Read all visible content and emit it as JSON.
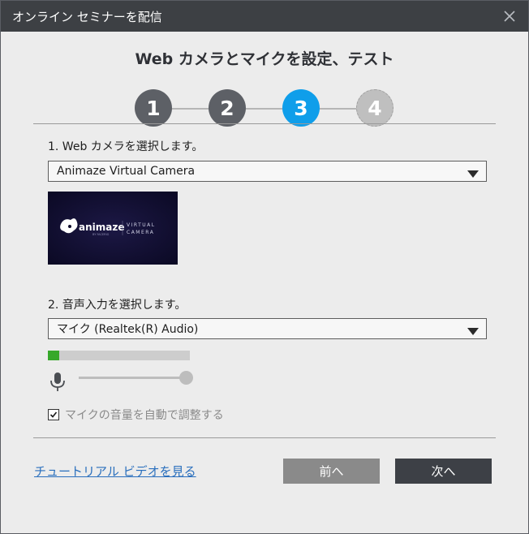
{
  "window": {
    "title": "オンライン セミナーを配信"
  },
  "wizard": {
    "heading": "Web カメラとマイクを設定、テスト",
    "steps": [
      {
        "label": "1",
        "state": "completed",
        "color": "#5d6066"
      },
      {
        "label": "2",
        "state": "completed",
        "color": "#5d6066"
      },
      {
        "label": "3",
        "state": "active",
        "color": "#0f9eea"
      },
      {
        "label": "4",
        "state": "upcoming",
        "color": "#bfbfbf"
      }
    ]
  },
  "camera": {
    "section_label": "1. Web カメラを選択します。",
    "selected": "Animaze Virtual Camera",
    "preview": {
      "logo_text": "animaze",
      "logo_subtext": "BY FACERIG",
      "side_text_line1": "VIRTUAL",
      "side_text_line2": "CAMERA"
    }
  },
  "audio": {
    "section_label": "2. 音声入力を選択します。",
    "selected": "マイク (Realtek(R) Audio)",
    "level_fraction": 0.08,
    "volume_fraction": 1.0,
    "auto_adjust_checked": true,
    "auto_adjust_label": "マイクの音量を自動で調整する"
  },
  "footer": {
    "tutorial_link": "チュートリアル ビデオを見る",
    "back_label": "前へ",
    "next_label": "次へ"
  },
  "colors": {
    "titlebar": "#3d4044",
    "active_step": "#0f9eea",
    "back_button": "#8a8a8a",
    "next_button": "#3d4046",
    "link": "#2a6fbd",
    "meter_fill": "#36a82a"
  }
}
